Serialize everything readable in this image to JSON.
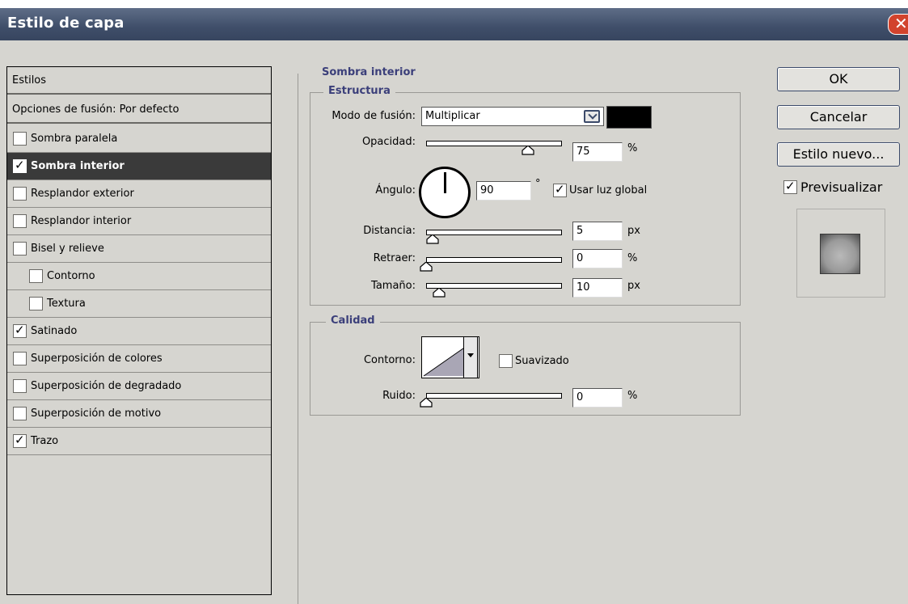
{
  "window": {
    "title": "Estilo de capa",
    "close_glyph": "✕"
  },
  "styles": {
    "header": "Estilos",
    "blending": "Opciones de fusión: Por defecto",
    "items": [
      {
        "label": "Sombra paralela",
        "checked": false
      },
      {
        "label": "Sombra interior",
        "checked": true,
        "selected": true
      },
      {
        "label": "Resplandor exterior",
        "checked": false
      },
      {
        "label": "Resplandor interior",
        "checked": false
      },
      {
        "label": "Bisel y relieve",
        "checked": false
      },
      {
        "label": "Contorno",
        "checked": false
      },
      {
        "label": "Textura",
        "checked": false
      },
      {
        "label": "Satinado",
        "checked": true
      },
      {
        "label": "Superposición de colores",
        "checked": false
      },
      {
        "label": "Superposición de degradado",
        "checked": false
      },
      {
        "label": "Superposición de motivo",
        "checked": false
      },
      {
        "label": "Trazo",
        "checked": true
      }
    ]
  },
  "inner_shadow": {
    "section_title": "Sombra interior",
    "structure": {
      "title": "Estructura",
      "blend_mode_label": "Modo de fusión:",
      "blend_mode_value": "Multiplicar",
      "blend_color": "#000000",
      "opacity_label": "Opacidad:",
      "opacity_value": "75",
      "opacity_unit": "%",
      "opacity_level": 0.75,
      "angle_label": "Ángulo:",
      "angle_value": "90",
      "angle_unit": "°",
      "global_light_label": "Usar luz global",
      "global_light_checked": true,
      "distance_label": "Distancia:",
      "distance_value": "5",
      "distance_unit": "px",
      "choke_label": "Retraer:",
      "choke_value": "0",
      "choke_unit": "%",
      "size_label": "Tamaño:",
      "size_value": "10",
      "size_unit": "px"
    },
    "quality": {
      "title": "Calidad",
      "contour_label": "Contorno:",
      "antialiased_label": "Suavizado",
      "antialiased_checked": false,
      "noise_label": "Ruido:",
      "noise_value": "0",
      "noise_unit": "%"
    }
  },
  "buttons": {
    "ok": "OK",
    "cancel": "Cancelar",
    "new_style": "Estilo nuevo...",
    "preview_label": "Previsualizar",
    "preview_checked": true
  }
}
